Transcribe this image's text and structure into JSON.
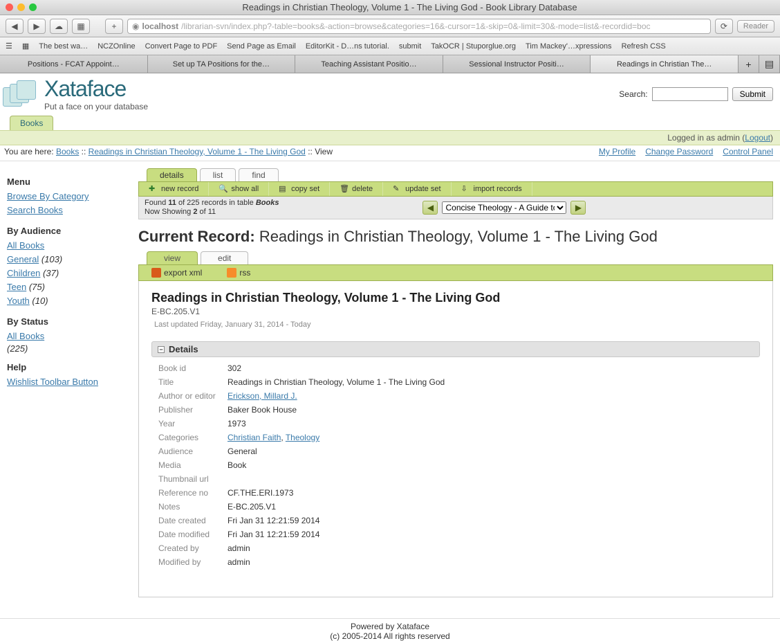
{
  "window": {
    "title": "Readings in Christian Theology, Volume 1 - The Living God - Book Library Database"
  },
  "url": {
    "host": "localhost",
    "path": "/librarian-svn/index.php?-table=books&-action=browse&categories=16&-cursor=1&-skip=0&-limit=30&-mode=list&-recordid=boc"
  },
  "reader": "Reader",
  "bookmarks": [
    "The best wa…",
    "NCZOnline",
    "Convert Page to PDF",
    "Send Page as Email",
    "EditorKit - D…ns tutorial.",
    "submit",
    "TakOCR | Stuporglue.org",
    "Tim Mackey'…xpressions",
    "Refresh CSS"
  ],
  "tabs": [
    "Positions - FCAT Appoint…",
    "Set up TA Positions for the…",
    "Teaching Assistant Positio…",
    "Sessional Instructor Positi…",
    "Readings in Christian The…"
  ],
  "logo": {
    "name": "Xataface",
    "tagline": "Put a face on your database"
  },
  "search": {
    "label": "Search:",
    "button": "Submit",
    "value": ""
  },
  "apptab": "Books",
  "login": {
    "prefix": "Logged in as admin (",
    "logout": "Logout",
    "suffix": ")"
  },
  "crumb": {
    "prefix": "You are here:",
    "p1": "Books",
    "p2": "Readings in Christian Theology, Volume 1 - The Living God",
    "p3": "View"
  },
  "toplinks": [
    "My Profile",
    "Change Password",
    "Control Panel"
  ],
  "sidebar": {
    "menu": "Menu",
    "browse": "Browse By Category",
    "searchbooks": "Search Books",
    "audience_h": "By Audience",
    "aud": [
      {
        "label": "All Books",
        "count": ""
      },
      {
        "label": "General",
        "count": "(103)"
      },
      {
        "label": "Children",
        "count": "(37)"
      },
      {
        "label": "Teen",
        "count": "(75)"
      },
      {
        "label": "Youth",
        "count": "(10)"
      }
    ],
    "status_h": "By Status",
    "status_all": "All Books",
    "status_count": "(225)",
    "help_h": "Help",
    "help_link": "Wishlist Toolbar Button"
  },
  "ctabs": {
    "details": "details",
    "list": "list",
    "find": "find"
  },
  "actions": {
    "new": "new record",
    "showall": "show all",
    "copy": "copy set",
    "delete": "delete",
    "update": "update set",
    "import": "import records"
  },
  "navinfo": {
    "l1a": "Found ",
    "l1b": "11",
    "l1c": " of 225 records in table ",
    "l1d": "Books",
    "l2a": "Now Showing ",
    "l2b": "2",
    "l2c": " of 11"
  },
  "navsel": "Concise Theology - A Guide to t",
  "current": {
    "label": "Current Record:",
    "title": "Readings in Christian Theology, Volume 1 - The Living God"
  },
  "vtabs": {
    "view": "view",
    "edit": "edit"
  },
  "export": {
    "xml": "export xml",
    "rss": "rss"
  },
  "record": {
    "title": "Readings in Christian Theology, Volume 1 - The Living God",
    "code": "E-BC.205.V1",
    "updated": "Last updated Friday, January 31, 2014 - Today",
    "dethead": "Details",
    "rows": {
      "bookid": {
        "l": "Book id",
        "v": "302"
      },
      "titler": {
        "l": "Title",
        "v": "Readings in Christian Theology, Volume 1 - The Living God"
      },
      "author": {
        "l": "Author or editor",
        "v": "Erickson, Millard J.",
        "link": true
      },
      "publisher": {
        "l": "Publisher",
        "v": "Baker Book House"
      },
      "year": {
        "l": "Year",
        "v": "1973"
      },
      "cats": {
        "l": "Categories",
        "c1": "Christian Faith",
        "c2": "Theology"
      },
      "audience": {
        "l": "Audience",
        "v": "General"
      },
      "media": {
        "l": "Media",
        "v": "Book"
      },
      "thumb": {
        "l": "Thumbnail url",
        "v": ""
      },
      "ref": {
        "l": "Reference no",
        "v": "CF.THE.ERI.1973"
      },
      "notes": {
        "l": "Notes",
        "v": "E-BC.205.V1"
      },
      "dcreated": {
        "l": "Date created",
        "v": "Fri Jan 31 12:21:59 2014"
      },
      "dmod": {
        "l": "Date modified",
        "v": "Fri Jan 31 12:21:59 2014"
      },
      "cby": {
        "l": "Created by",
        "v": "admin"
      },
      "mby": {
        "l": "Modified by",
        "v": "admin"
      }
    }
  },
  "footer": {
    "l1": "Powered by Xataface",
    "l2": "(c) 2005-2014 All rights reserved"
  }
}
